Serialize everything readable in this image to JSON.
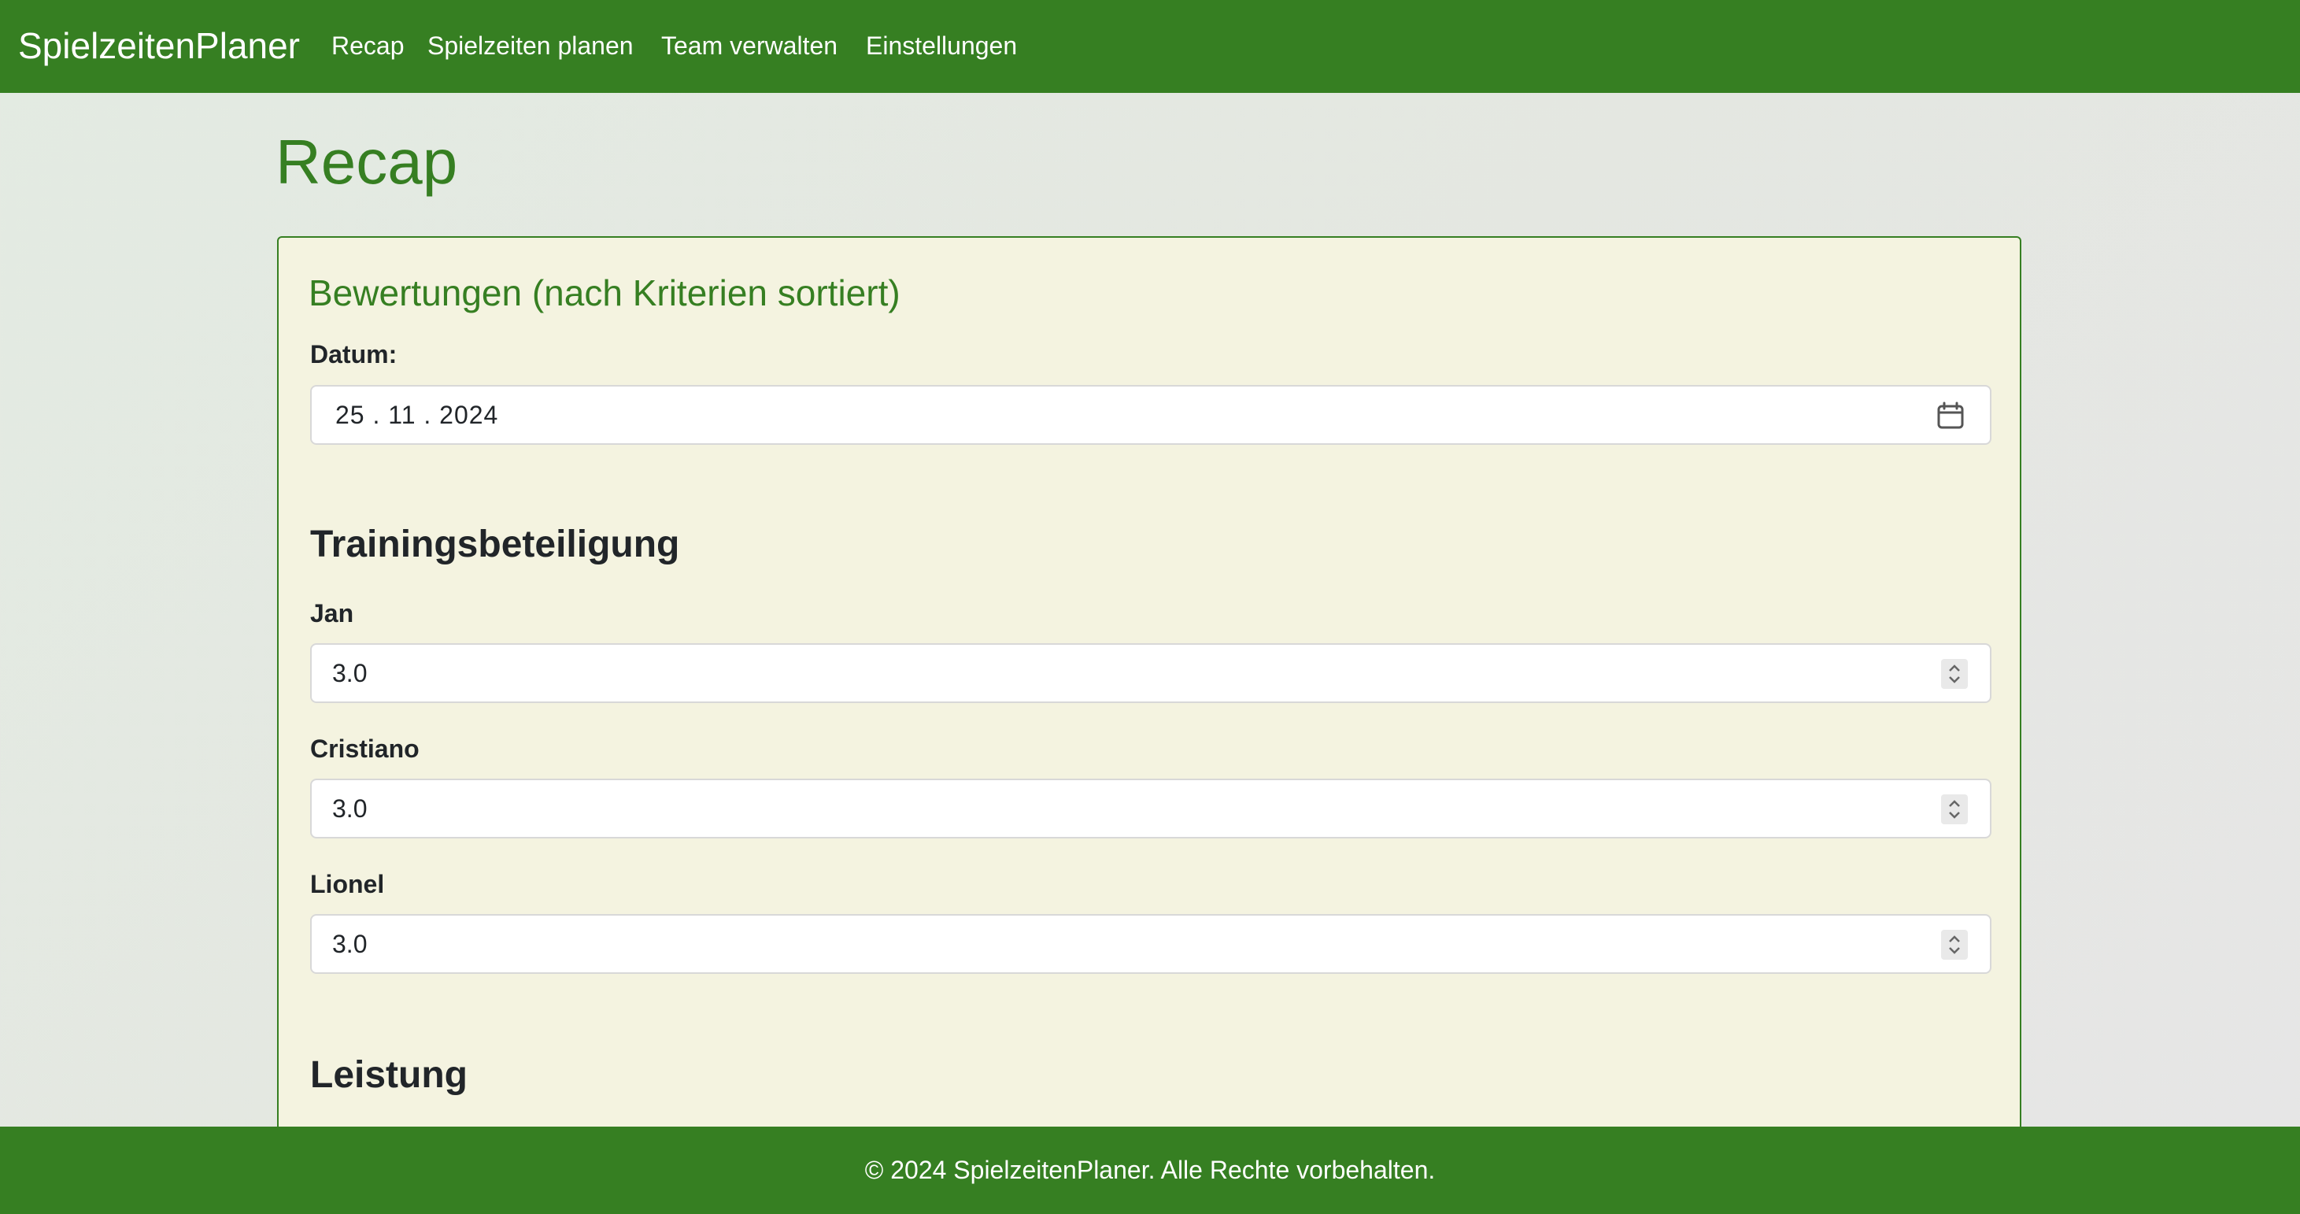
{
  "navbar": {
    "brand": "SpielzeitenPlaner",
    "items": [
      {
        "label": "Recap"
      },
      {
        "label": "Spielzeiten planen"
      },
      {
        "label": "Team verwalten"
      },
      {
        "label": "Einstellungen"
      }
    ]
  },
  "page": {
    "title": "Recap"
  },
  "card": {
    "title": "Bewertungen (nach Kriterien sortiert)",
    "date": {
      "label": "Datum:",
      "value": "25 . 11 . 2024",
      "icon": "calendar-icon"
    },
    "sections": [
      {
        "heading": "Trainingsbeteiligung",
        "players": [
          {
            "name": "Jan",
            "value": "3.0"
          },
          {
            "name": "Cristiano",
            "value": "3.0"
          },
          {
            "name": "Lionel",
            "value": "3.0"
          }
        ]
      },
      {
        "heading": "Leistung"
      }
    ]
  },
  "footer": {
    "text": "© 2024 SpielzeitenPlaner. Alle Rechte vorbehalten."
  },
  "colors": {
    "primary": "#367f22",
    "card_background": "#f4f3e0",
    "text": "#212529"
  }
}
